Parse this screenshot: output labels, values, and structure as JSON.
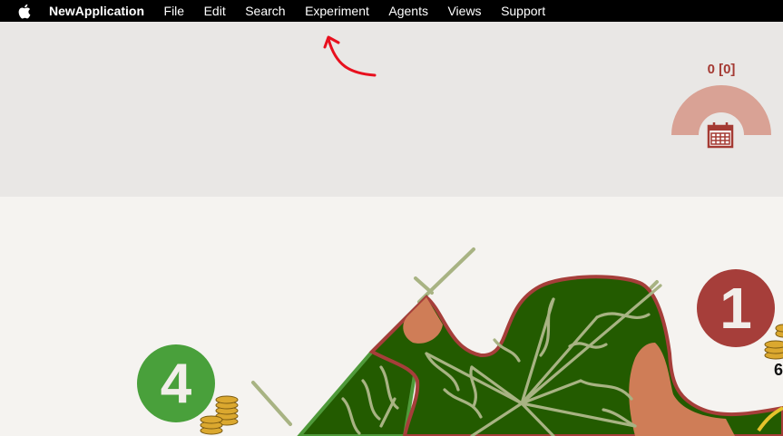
{
  "menubar": {
    "apple_icon": "apple-logo-icon",
    "app_name": "NewApplication",
    "items": [
      "File",
      "Edit",
      "Search",
      "Experiment",
      "Agents",
      "Views",
      "Support"
    ]
  },
  "gauge": {
    "value_text": "0 [0]",
    "icon": "calendar-icon",
    "arc_color": "#d9a295",
    "text_color": "#a43a33"
  },
  "annotation": {
    "icon": "red-arrow-icon",
    "color": "#e8101e"
  },
  "board": {
    "badges": [
      {
        "label": "1",
        "color": "#a63e3a"
      },
      {
        "label": "4",
        "color": "#49a03b"
      }
    ],
    "partial_number": "6",
    "coin_icon": "coin-stack-icon",
    "forest_color": "#235b00",
    "border_color": "#a63e3a",
    "road_color": "#a8b383"
  }
}
